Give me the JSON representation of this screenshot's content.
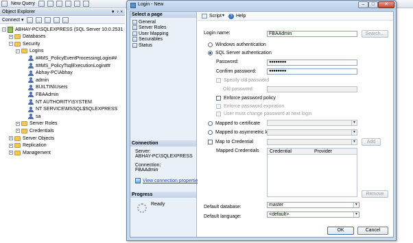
{
  "ssms": {
    "new_query_label": "New Query",
    "object_explorer": {
      "title": "Object Explorer",
      "pin": "▼ ♀ ×",
      "connect_label": "Connect ▾",
      "tree": [
        {
          "label": "ABHAY-PC\\SQLEXPRESS (SQL Server 10.0.2531 - FBAA",
          "indent": 0,
          "exp": "−",
          "icon": "server"
        },
        {
          "label": "Databases",
          "indent": 1,
          "exp": "+",
          "icon": "folder"
        },
        {
          "label": "Security",
          "indent": 1,
          "exp": "−",
          "icon": "folder"
        },
        {
          "label": "Logins",
          "indent": 2,
          "exp": "−",
          "icon": "folder"
        },
        {
          "label": "##MS_PolicyEventProcessingLogin##",
          "indent": 3,
          "exp": "",
          "icon": "user"
        },
        {
          "label": "##MS_PolicyTsqlExecutionLogin##",
          "indent": 3,
          "exp": "",
          "icon": "user"
        },
        {
          "label": "Abhay-PC\\Abhay",
          "indent": 3,
          "exp": "",
          "icon": "user"
        },
        {
          "label": "admin",
          "indent": 3,
          "exp": "",
          "icon": "user"
        },
        {
          "label": "BUILTIN\\Users",
          "indent": 3,
          "exp": "",
          "icon": "user"
        },
        {
          "label": "FBAAdmin",
          "indent": 3,
          "exp": "",
          "icon": "user"
        },
        {
          "label": "NT AUTHORITY\\SYSTEM",
          "indent": 3,
          "exp": "",
          "icon": "user"
        },
        {
          "label": "NT SERVICE\\MSSQL$SQLEXPRESS",
          "indent": 3,
          "exp": "",
          "icon": "user"
        },
        {
          "label": "sa",
          "indent": 3,
          "exp": "",
          "icon": "user"
        },
        {
          "label": "Server Roles",
          "indent": 2,
          "exp": "+",
          "icon": "folder"
        },
        {
          "label": "Credentials",
          "indent": 2,
          "exp": "+",
          "icon": "folder"
        },
        {
          "label": "Server Objects",
          "indent": 1,
          "exp": "+",
          "icon": "folder"
        },
        {
          "label": "Replication",
          "indent": 1,
          "exp": "+",
          "icon": "folder"
        },
        {
          "label": "Management",
          "indent": 1,
          "exp": "+",
          "icon": "folder"
        }
      ]
    }
  },
  "dialog": {
    "title": "Login - New",
    "select_page": "Select a page",
    "pages": [
      "General",
      "Server Roles",
      "User Mapping",
      "Securables",
      "Status"
    ],
    "connection": {
      "header": "Connection",
      "server_label": "Server:",
      "server_value": "ABHAY-PC\\SQLEXPRESS",
      "conn_label": "Connection:",
      "conn_value": "FBAAdmin",
      "view_link": "View connection properties"
    },
    "progress": {
      "header": "Progress",
      "status": "Ready"
    },
    "toolbar": {
      "script": "Script",
      "help": "Help"
    },
    "form": {
      "login_name_label": "Login name:",
      "login_name_value": "FBAAdmin",
      "search_label": "Search...",
      "windows_auth": "Windows authentication",
      "sql_auth": "SQL Server authentication",
      "password_label": "Password:",
      "password_value": "●●●●●●●●",
      "confirm_label": "Confirm password:",
      "confirm_value": "●●●●●●●●",
      "specify_old": "Specify old password",
      "old_password_label": "Old password:",
      "enforce_policy": "Enforce password policy",
      "enforce_expiration": "Enforce password expiration",
      "must_change": "User must change password at next login",
      "mapped_cert": "Mapped to certificate",
      "mapped_asym": "Mapped to asymmetric key",
      "map_credential": "Map to Credential",
      "add_label": "Add",
      "mapped_credentials": "Mapped Credentials",
      "grid_credential": "Credential",
      "grid_provider": "Provider",
      "remove_label": "Remove",
      "default_db_label": "Default database:",
      "default_db_value": "master",
      "default_lang_label": "Default language:",
      "default_lang_value": "<default>"
    },
    "ok_label": "OK",
    "cancel_label": "Cancel"
  }
}
